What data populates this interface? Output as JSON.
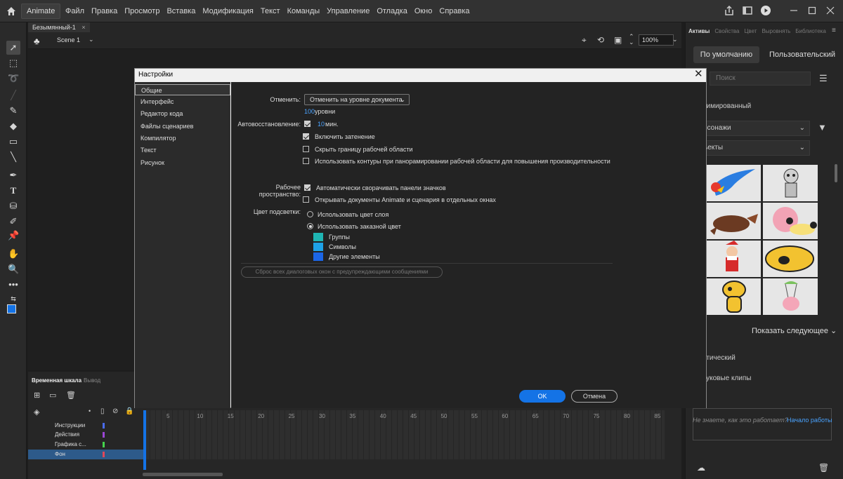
{
  "app": {
    "name": "Animate",
    "menu": [
      "Файл",
      "Правка",
      "Просмотр",
      "Вставка",
      "Модификация",
      "Текст",
      "Команды",
      "Управление",
      "Отладка",
      "Окно",
      "Справка"
    ]
  },
  "document": {
    "tab": "Безымянный-1",
    "tab_close": "×",
    "scene": "Scene 1",
    "zoom": "100%"
  },
  "timeline": {
    "tabs": [
      "Временная шкала",
      "Вывод"
    ],
    "layers": [
      {
        "name": "Инструкции",
        "color": "#4a6cf0"
      },
      {
        "name": "Действия",
        "color": "#9b46d6"
      },
      {
        "name": "Графика с...",
        "color": "#44d44c"
      },
      {
        "name": "Фон",
        "color": "#e0485a"
      }
    ],
    "frame_numbers": [
      "5",
      "10",
      "15",
      "20",
      "25",
      "30",
      "35",
      "40",
      "45",
      "50",
      "55",
      "60",
      "65",
      "70",
      "75",
      "80",
      "85"
    ]
  },
  "right_panel": {
    "tabs": [
      "Активы",
      "Свойства",
      "Цвет",
      "Выровнять",
      "Библиотека"
    ],
    "default_btn": "По умолчанию",
    "custom_btn": "Пользовательский",
    "search_placeholder": "Поиск",
    "animated_label": "нимированный",
    "characters_dropdown": "рсонажи",
    "objects_dropdown": "ъекты",
    "show_next": "Показать следующее",
    "static_label": "атический",
    "sound_clips_label": "вуковые клипы",
    "help_text": "Не знаете, как это работает?",
    "help_link": "Начало работы"
  },
  "dialog": {
    "title": "Настройки",
    "nav": [
      "Общие",
      "Интерфейс",
      "Редактор кода",
      "Файлы сценариев",
      "Компилятор",
      "Текст",
      "Рисунок"
    ],
    "undo_label": "Отменить:",
    "undo_value": "Отменить на уровне документа",
    "levels_num": "100",
    "levels_label": "уровни",
    "autorecover_label": "Автовосстановление:",
    "autorecover_num": "10",
    "autorecover_unit": "мин.",
    "options1": [
      {
        "label": "Включить затенение",
        "checked": true
      },
      {
        "label": "Скрыть границу рабочей области",
        "checked": false
      },
      {
        "label": "Использовать контуры при панорамировании рабочей области для повышения производительности",
        "checked": false
      }
    ],
    "workspace_label": "Рабочее пространство:",
    "options2": [
      {
        "label": "Автоматически сворачивать панели значков",
        "checked": true
      },
      {
        "label": "Открывать документы Animate и сценария в отдельных окнах",
        "checked": false
      }
    ],
    "highlight_label": "Цвет подсветки:",
    "radio_layer": "Использовать цвет слоя",
    "radio_custom": "Использовать заказной цвет",
    "swatches": [
      {
        "label": "Группы",
        "color": "#1fb5b3"
      },
      {
        "label": "Символы",
        "color": "#1ea2e8"
      },
      {
        "label": "Другие элементы",
        "color": "#1b66e6"
      }
    ],
    "reset_btn": "Сброс всех диалоговых окон с предупреждающими сообщениями",
    "ok": "OK",
    "cancel": "Отмена"
  }
}
